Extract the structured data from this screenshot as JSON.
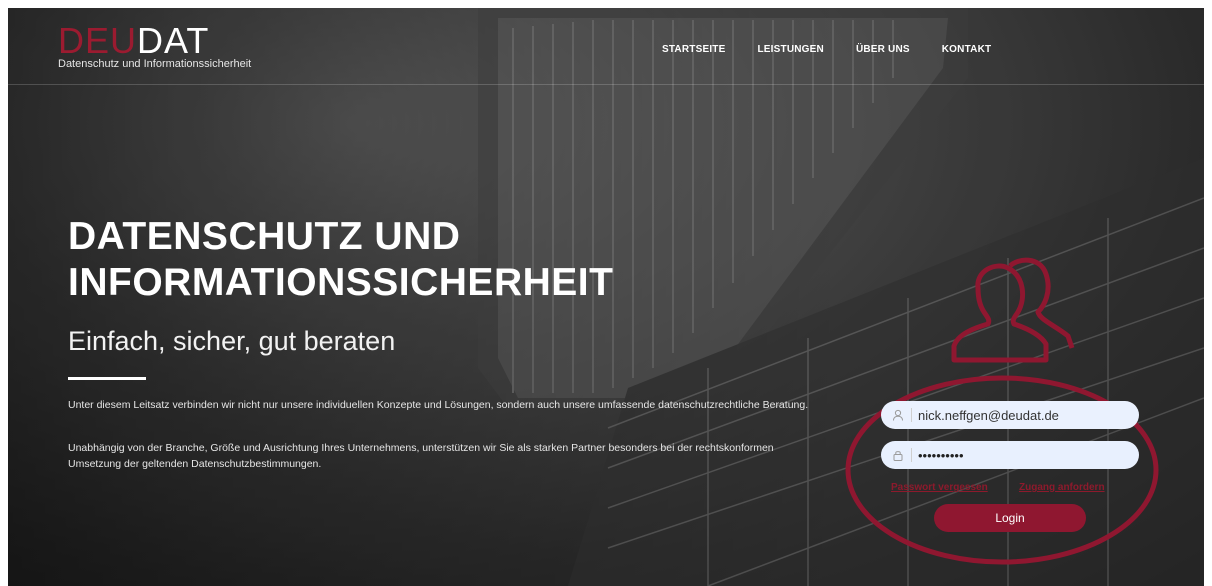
{
  "brand": {
    "logo_part1": "DEU",
    "logo_part2": "DAT",
    "tagline": "Datenschutz und Informationssicherheit",
    "accent_color": "#9b1b30"
  },
  "nav": {
    "items": [
      {
        "label": "STARTSEITE"
      },
      {
        "label": "LEISTUNGEN"
      },
      {
        "label": "ÜBER UNS"
      },
      {
        "label": "KONTAKT"
      }
    ]
  },
  "hero": {
    "title_line1": "DATENSCHUTZ UND",
    "title_line2": "INFORMATIONSSICHERHEIT",
    "subtitle": "Einfach, sicher, gut beraten",
    "paragraph1": "Unter diesem Leitsatz verbinden wir nicht nur unsere individuellen Konzepte und Lösungen, sondern auch unsere umfassende datenschutzrechtliche Beratung.",
    "paragraph2": "Unabhängig von der Branche, Größe und Ausrichtung Ihres Unternehmens, unterstützen wir Sie als starken Partner besonders bei der rechtskonformen Umsetzung der geltenden Datenschutzbestimmungen."
  },
  "login": {
    "email_value": "nick.neffgen@deudat.de",
    "password_value": "••••••••••",
    "forgot_label": "Passwort vergessen",
    "request_label": "Zugang anfordern",
    "login_label": "Login",
    "icons": [
      "user-icon",
      "lock-icon",
      "person-outline-icon"
    ]
  }
}
